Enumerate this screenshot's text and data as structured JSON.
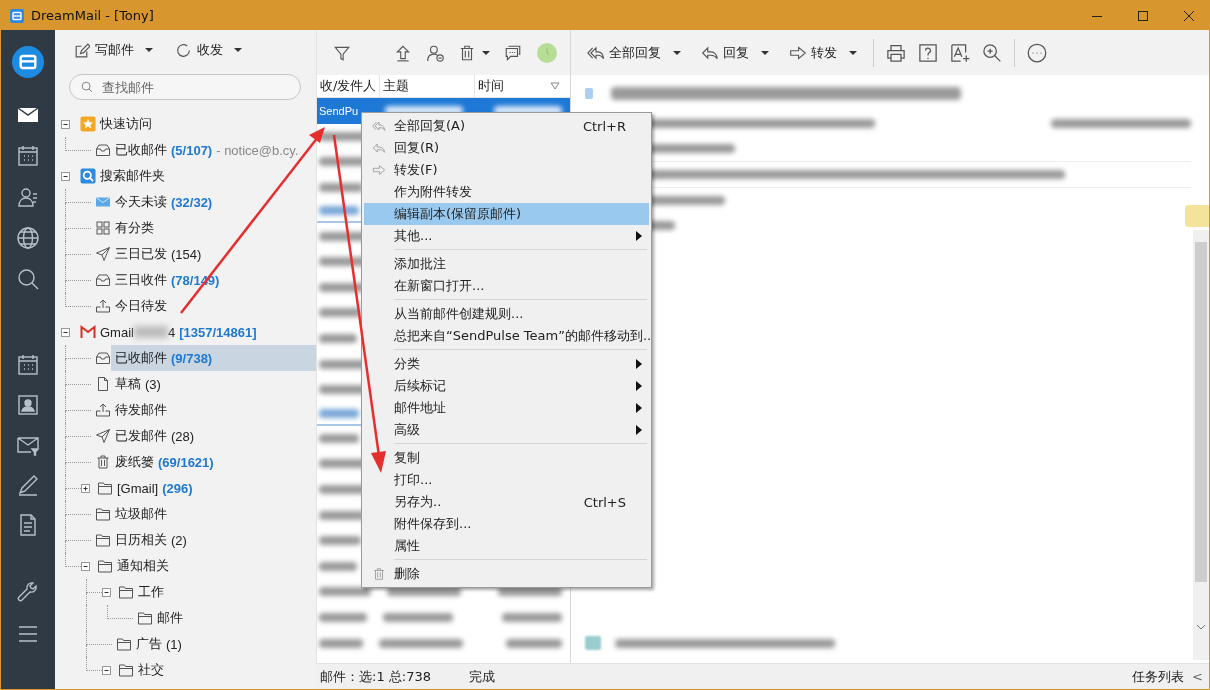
{
  "window": {
    "title": "DreamMail - [Tony]"
  },
  "rail": {
    "top": [
      {
        "kind": "logo"
      },
      {
        "kind": "mail",
        "selected": true
      },
      {
        "kind": "calendar",
        "selected": false
      },
      {
        "kind": "contacts",
        "selected": false
      },
      {
        "kind": "globe",
        "selected": false
      },
      {
        "kind": "search",
        "selected": false
      }
    ],
    "middle": [
      {
        "kind": "calendar",
        "selected": false
      },
      {
        "kind": "card",
        "selected": false
      },
      {
        "kind": "mail-filter",
        "selected": false
      },
      {
        "kind": "pen",
        "selected": false
      },
      {
        "kind": "notes",
        "selected": false
      }
    ],
    "bottom": [
      {
        "kind": "wrench",
        "selected": false
      },
      {
        "kind": "menu",
        "selected": false
      }
    ]
  },
  "folder_toolbar": [
    {
      "label": "写邮件",
      "kind": "compose",
      "has_menu": true
    },
    {
      "label": "收发",
      "kind": "sync",
      "has_menu": true
    }
  ],
  "search": {
    "placeholder": "查找邮件"
  },
  "folders": [
    {
      "label": "快速访问",
      "kind": "star",
      "selected": false,
      "expanded": true,
      "children": [
        {
          "label": "已收邮件",
          "kind": "inbox",
          "count": "(5/107)",
          "unread": true,
          "suffix": "- notice@b.cy.",
          "selected": false
        }
      ]
    },
    {
      "label": "搜索邮件夹",
      "kind": "search",
      "selected": false,
      "expanded": true,
      "children": [
        {
          "label": "今天未读",
          "kind": "mail",
          "count": "(32/32)",
          "unread": true,
          "selected": false
        },
        {
          "label": "有分类",
          "kind": "grid",
          "selected": false
        },
        {
          "label": "三日已发",
          "kind": "sent",
          "count": "(154)",
          "unread": false,
          "selected": false
        },
        {
          "label": "三日收件",
          "kind": "inbox",
          "count": "(78/149)",
          "unread": true,
          "selected": false
        },
        {
          "label": "今日待发",
          "kind": "outbox",
          "selected": false
        }
      ]
    },
    {
      "label": "Gmail",
      "label_end": "4",
      "kind": "gmail",
      "count": "[1357/14861]",
      "unread": true,
      "selected": false,
      "expanded": true,
      "children": [
        {
          "label": "已收邮件",
          "kind": "inbox",
          "count": "(9/738)",
          "unread": true,
          "selected": true
        },
        {
          "label": "草稿",
          "kind": "doc",
          "count": "(3)",
          "unread": false,
          "selected": false
        },
        {
          "label": "待发邮件",
          "kind": "outbox",
          "selected": false
        },
        {
          "label": "已发邮件",
          "kind": "sent",
          "count": "(28)",
          "unread": false,
          "selected": false
        },
        {
          "label": "废纸篓",
          "kind": "trash",
          "count": "(69/1621)",
          "unread": true,
          "selected": false
        },
        {
          "label": "[Gmail]",
          "kind": "folder",
          "count": "(296)",
          "unread": true,
          "selected": false,
          "expanded": false
        },
        {
          "label": "垃圾邮件",
          "kind": "folder",
          "selected": false
        },
        {
          "label": "日历相关",
          "kind": "folder",
          "count": "(2)",
          "unread": false,
          "selected": false
        },
        {
          "label": "通知相关",
          "kind": "folder",
          "selected": false,
          "expanded": true,
          "children": [
            {
              "label": "工作",
              "kind": "folder",
              "selected": false,
              "expanded": true,
              "children": [
                {
                  "label": "邮件",
                  "kind": "folder",
                  "selected": false
                }
              ]
            },
            {
              "label": "广告",
              "kind": "folder",
              "count": "(1)",
              "unread": false,
              "selected": false
            },
            {
              "label": "社交",
              "kind": "folder",
              "selected": false,
              "expanded": true
            }
          ]
        }
      ]
    }
  ],
  "message_list": {
    "columns": [
      "收/发件人",
      "主题",
      "时间"
    ],
    "rows": [
      {
        "kind": "message",
        "selected": true,
        "sender": "SendPu"
      },
      {
        "kind": "message",
        "selected": false
      },
      {
        "kind": "message",
        "selected": false
      },
      {
        "kind": "message",
        "selected": false
      },
      {
        "kind": "group",
        "selected": false
      },
      {
        "kind": "message",
        "selected": false
      },
      {
        "kind": "message",
        "selected": false
      },
      {
        "kind": "message",
        "selected": false
      },
      {
        "kind": "message",
        "selected": false
      },
      {
        "kind": "message",
        "selected": false
      },
      {
        "kind": "message",
        "selected": false
      },
      {
        "kind": "message",
        "selected": false
      },
      {
        "kind": "group",
        "selected": false
      },
      {
        "kind": "message",
        "selected": false
      },
      {
        "kind": "message",
        "selected": false
      },
      {
        "kind": "message",
        "selected": false
      },
      {
        "kind": "message",
        "selected": false
      },
      {
        "kind": "message",
        "selected": false
      },
      {
        "kind": "message",
        "selected": false
      },
      {
        "kind": "message",
        "selected": false
      },
      {
        "kind": "message",
        "selected": false
      },
      {
        "kind": "message",
        "selected": false
      }
    ]
  },
  "context_menu": {
    "items": [
      {
        "kind": "reply-all",
        "label": "全部回复(A)",
        "shortcut": "Ctrl+R",
        "submenu": false,
        "selected": false
      },
      {
        "kind": "reply",
        "label": "回复(R)",
        "submenu": false,
        "selected": false
      },
      {
        "kind": "forward",
        "label": "转发(F)",
        "submenu": false,
        "selected": false
      },
      {
        "kind": "item",
        "label": "作为附件转发",
        "submenu": false,
        "selected": false
      },
      {
        "kind": "item",
        "label": "编辑副本(保留原邮件)",
        "submenu": false,
        "selected": true
      },
      {
        "kind": "item",
        "label": "其他...",
        "submenu": true,
        "selected": false
      },
      {
        "kind": "separator"
      },
      {
        "kind": "item",
        "label": "添加批注",
        "submenu": false,
        "selected": false
      },
      {
        "kind": "item",
        "label": "在新窗口打开...",
        "submenu": false,
        "selected": false
      },
      {
        "kind": "separator"
      },
      {
        "kind": "item",
        "label": "从当前邮件创建规则...",
        "submenu": false,
        "selected": false
      },
      {
        "kind": "item",
        "label": "总把来自“SendPulse Team”的邮件移动到..",
        "submenu": false,
        "selected": false
      },
      {
        "kind": "separator"
      },
      {
        "kind": "item",
        "label": "分类",
        "submenu": true,
        "selected": false
      },
      {
        "kind": "item",
        "label": "后续标记",
        "submenu": true,
        "selected": false
      },
      {
        "kind": "item",
        "label": "邮件地址",
        "submenu": true,
        "selected": false
      },
      {
        "kind": "item",
        "label": "高级",
        "submenu": true,
        "selected": false
      },
      {
        "kind": "separator"
      },
      {
        "kind": "item",
        "label": "复制",
        "submenu": false,
        "selected": false
      },
      {
        "kind": "item",
        "label": "打印...",
        "submenu": false,
        "selected": false
      },
      {
        "kind": "item",
        "label": "另存为..",
        "shortcut": "Ctrl+S",
        "submenu": false,
        "selected": false
      },
      {
        "kind": "item",
        "label": "附件保存到...",
        "submenu": false,
        "selected": false
      },
      {
        "kind": "item",
        "label": "属性",
        "submenu": false,
        "selected": false
      },
      {
        "kind": "separator"
      },
      {
        "kind": "delete",
        "label": "删除",
        "submenu": false,
        "selected": false
      }
    ]
  },
  "reader_toolbar": [
    {
      "label": "全部回复",
      "kind": "reply-all",
      "has_menu": true
    },
    {
      "label": "回复",
      "kind": "reply",
      "has_menu": true
    },
    {
      "label": "转发",
      "kind": "forward",
      "has_menu": true
    }
  ],
  "status_bar": {
    "selection": "邮件：选:1 总:738",
    "state": "完成",
    "task_list": "任务列表",
    "task_toggle": "<"
  }
}
